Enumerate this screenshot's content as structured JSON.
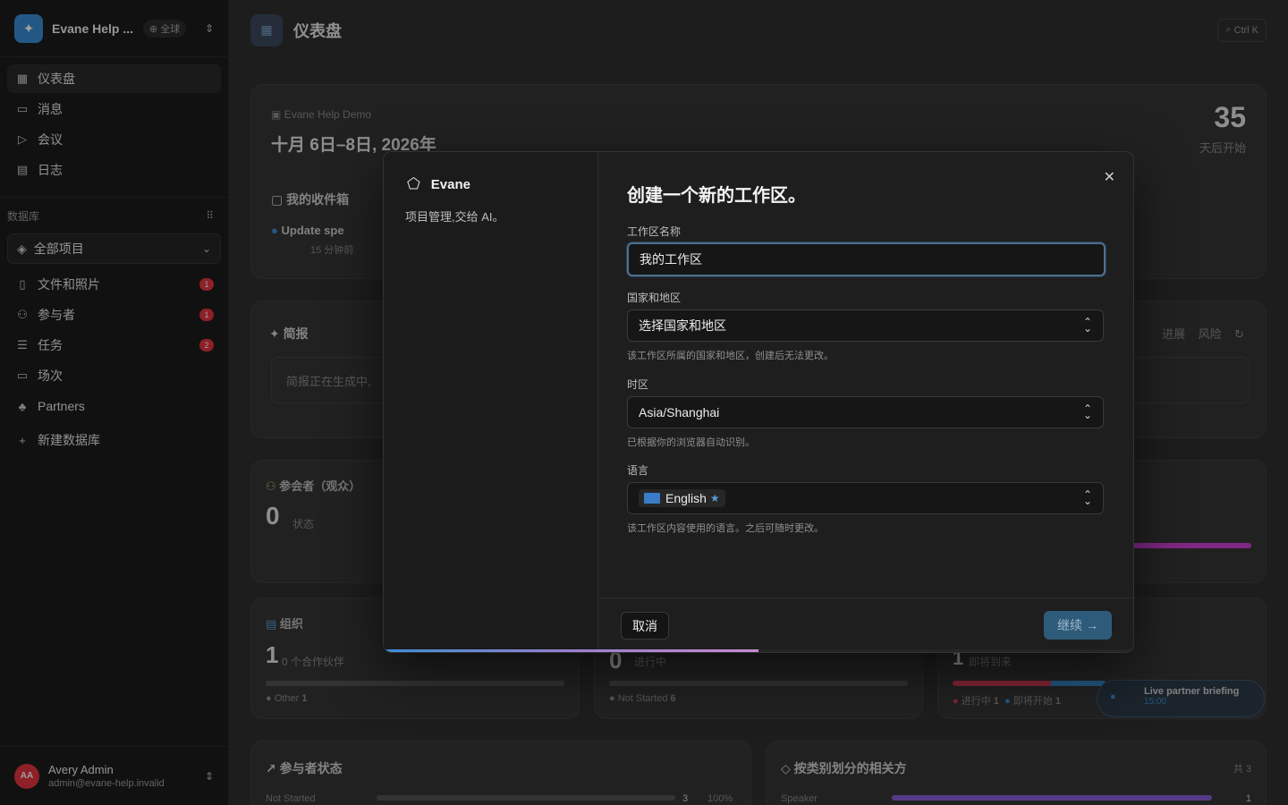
{
  "workspace": {
    "name": "Evane Help ...",
    "badge": "全球"
  },
  "nav": [
    {
      "label": "仪表盘",
      "icon": "dashboard-icon",
      "active": true
    },
    {
      "label": "消息",
      "icon": "message-icon",
      "active": false
    },
    {
      "label": "会议",
      "icon": "video-icon",
      "active": false
    },
    {
      "label": "日志",
      "icon": "log-icon",
      "active": false
    }
  ],
  "databases": {
    "section_label": "数据库",
    "selector": "全部项目",
    "items": [
      {
        "label": "文件和照片",
        "count": "1"
      },
      {
        "label": "参与者",
        "count": "1"
      },
      {
        "label": "任务",
        "count": "2"
      },
      {
        "label": "场次",
        "count": ""
      },
      {
        "label": "Partners",
        "count": ""
      }
    ],
    "new_label": "新建数据库"
  },
  "user": {
    "initials": "AA",
    "name": "Avery Admin",
    "email": "admin@evane-help.invalid"
  },
  "main": {
    "title": "仪表盘",
    "search_shortcut": "Ctrl K",
    "event": {
      "name": "Evane Help Demo",
      "dates": "十月 6日–8日, 2026年",
      "days": "35",
      "days_label": "天后开始"
    },
    "inbox": {
      "title": "我的收件箱",
      "item": "Update spe",
      "item_time": "15 分钟前"
    },
    "brief": {
      "title": "简报",
      "text": "简报正在生成中,",
      "tab_progress": "进展",
      "tab_risk": "风险"
    },
    "attendees": {
      "title": "参会者（观众）",
      "value": "0",
      "label": "状态"
    },
    "org": {
      "title": "组织",
      "value": "1",
      "label": "0 个合作伙伴",
      "legend": "Other",
      "legend_count": "1"
    },
    "tasks": {
      "value": "0",
      "label": "进行中",
      "legend": "Not Started",
      "legend_count": "6"
    },
    "sessions": {
      "value": "1",
      "label": "即将到来",
      "legend_a": "进行中",
      "count_a": "1",
      "legend_b": "即将开始",
      "count_b": "1"
    },
    "toast": {
      "title": "Live partner briefing",
      "time": "15:00"
    },
    "participant_status": {
      "title": "参与者状态",
      "row": "Not Started",
      "count": "3",
      "pct": "100%"
    },
    "related": {
      "title": "按类别划分的相关方",
      "total": "共 3",
      "row": "Speaker",
      "count": "1"
    }
  },
  "modal": {
    "brand": "Evane",
    "tagline": "项目管理,交给 AI。",
    "title": "创建一个新的工作区。",
    "name_label": "工作区名称",
    "name_value": "我的工作区",
    "country_label": "国家和地区",
    "country_placeholder": "选择国家和地区",
    "country_hint": "该工作区所属的国家和地区，创建后无法更改。",
    "tz_label": "时区",
    "tz_value": "Asia/Shanghai",
    "tz_hint": "已根据你的浏览器自动识别。",
    "lang_label": "语言",
    "lang_value": "English",
    "lang_hint": "该工作区内容使用的语言。之后可随时更改。",
    "cancel": "取消",
    "continue": "继续",
    "progress": 0.5
  }
}
